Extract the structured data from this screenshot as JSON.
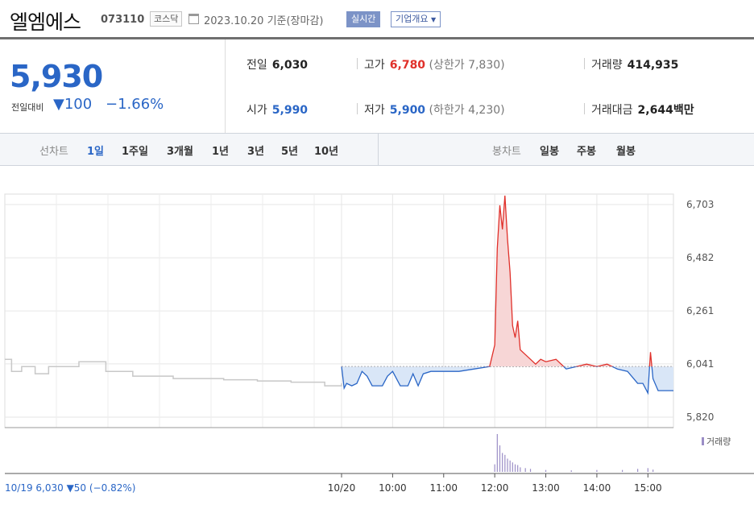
{
  "header": {
    "company": "엘엠에스",
    "code": "073110",
    "market": "코스닥",
    "date": "2023.10.20 기준(장마감)",
    "realtime_label": "실시간",
    "overview_label": "기업개요"
  },
  "price": {
    "current": "5,930",
    "diff_label": "전일대비",
    "diff_value": "100",
    "diff_arrow": "▼",
    "diff_pct": "−1.66%"
  },
  "stats": {
    "prev_label": "전일",
    "prev": "6,030",
    "high_label": "고가",
    "high": "6,780",
    "upper_limit": "(상한가 7,830)",
    "volume_label": "거래량",
    "volume": "414,935",
    "open_label": "시가",
    "open": "5,990",
    "low_label": "저가",
    "low": "5,900",
    "lower_limit": "(하한가 4,230)",
    "amount_label": "거래대금",
    "amount": "2,644",
    "amount_unit": "백만"
  },
  "tabs": {
    "line_label": "선차트",
    "line_periods": [
      "1일",
      "1주일",
      "3개월",
      "1년",
      "3년",
      "5년",
      "10년"
    ],
    "active_period": "1일",
    "candle_label": "봉차트",
    "candle_periods": [
      "일봉",
      "주봉",
      "월봉"
    ]
  },
  "chart_data": {
    "type": "line",
    "y_ticks": [
      "6,703",
      "6,482",
      "6,261",
      "6,041",
      "5,820"
    ],
    "ylim": [
      5820,
      6703
    ],
    "reference_price": 6030,
    "volume_legend": "거래량",
    "x_labels": [
      "10/20",
      "10:00",
      "11:00",
      "12:00",
      "13:00",
      "14:00",
      "15:00"
    ],
    "prev_day_note": "10/19 6,030 ▼50 (−0.82%)",
    "colors": {
      "up": "#e0302a",
      "down": "#2a66c6",
      "prev": "#c8c8c8",
      "volume": "#9b8ec6"
    },
    "prev_day_series": [
      [
        0,
        6060
      ],
      [
        0.02,
        6010
      ],
      [
        0.05,
        6030
      ],
      [
        0.09,
        6000
      ],
      [
        0.13,
        6030
      ],
      [
        0.18,
        6030
      ],
      [
        0.22,
        6050
      ],
      [
        0.26,
        6050
      ],
      [
        0.3,
        6010
      ],
      [
        0.34,
        6010
      ],
      [
        0.38,
        5990
      ],
      [
        0.42,
        5990
      ],
      [
        0.46,
        5990
      ],
      [
        0.5,
        5980
      ],
      [
        0.55,
        5980
      ],
      [
        0.6,
        5980
      ],
      [
        0.65,
        5975
      ],
      [
        0.7,
        5975
      ],
      [
        0.75,
        5970
      ],
      [
        0.8,
        5970
      ],
      [
        0.85,
        5965
      ],
      [
        0.9,
        5965
      ],
      [
        0.95,
        5950
      ],
      [
        1.0,
        5960
      ]
    ],
    "today_series": [
      [
        9.0,
        6030
      ],
      [
        9.05,
        5940
      ],
      [
        9.1,
        5960
      ],
      [
        9.2,
        5950
      ],
      [
        9.3,
        5960
      ],
      [
        9.4,
        6010
      ],
      [
        9.5,
        5990
      ],
      [
        9.6,
        5950
      ],
      [
        9.8,
        5950
      ],
      [
        9.9,
        5990
      ],
      [
        10.0,
        6010
      ],
      [
        10.15,
        5950
      ],
      [
        10.3,
        5950
      ],
      [
        10.4,
        6000
      ],
      [
        10.5,
        5950
      ],
      [
        10.6,
        6000
      ],
      [
        10.75,
        6010
      ],
      [
        11.0,
        6010
      ],
      [
        11.3,
        6010
      ],
      [
        11.6,
        6020
      ],
      [
        11.9,
        6030
      ],
      [
        12.0,
        6120
      ],
      [
        12.05,
        6520
      ],
      [
        12.1,
        6700
      ],
      [
        12.15,
        6600
      ],
      [
        12.2,
        6740
      ],
      [
        12.25,
        6560
      ],
      [
        12.3,
        6420
      ],
      [
        12.35,
        6200
      ],
      [
        12.4,
        6150
      ],
      [
        12.45,
        6220
      ],
      [
        12.5,
        6100
      ],
      [
        12.6,
        6080
      ],
      [
        12.7,
        6060
      ],
      [
        12.8,
        6040
      ],
      [
        12.9,
        6060
      ],
      [
        13.0,
        6050
      ],
      [
        13.2,
        6060
      ],
      [
        13.4,
        6020
      ],
      [
        13.6,
        6030
      ],
      [
        13.8,
        6040
      ],
      [
        14.0,
        6030
      ],
      [
        14.2,
        6040
      ],
      [
        14.4,
        6020
      ],
      [
        14.6,
        6010
      ],
      [
        14.8,
        5960
      ],
      [
        14.9,
        5960
      ],
      [
        15.0,
        5920
      ],
      [
        15.05,
        6090
      ],
      [
        15.1,
        5980
      ],
      [
        15.2,
        5930
      ],
      [
        15.5,
        5930
      ]
    ],
    "volume_bars": [
      [
        12.0,
        0.2
      ],
      [
        12.05,
        1.0
      ],
      [
        12.1,
        0.7
      ],
      [
        12.15,
        0.5
      ],
      [
        12.2,
        0.45
      ],
      [
        12.25,
        0.35
      ],
      [
        12.3,
        0.3
      ],
      [
        12.35,
        0.25
      ],
      [
        12.4,
        0.2
      ],
      [
        12.45,
        0.18
      ],
      [
        12.5,
        0.12
      ],
      [
        12.6,
        0.1
      ],
      [
        12.7,
        0.08
      ],
      [
        13.0,
        0.05
      ],
      [
        13.5,
        0.04
      ],
      [
        14.0,
        0.05
      ],
      [
        14.5,
        0.05
      ],
      [
        14.8,
        0.08
      ],
      [
        15.0,
        0.1
      ],
      [
        15.1,
        0.06
      ]
    ]
  }
}
